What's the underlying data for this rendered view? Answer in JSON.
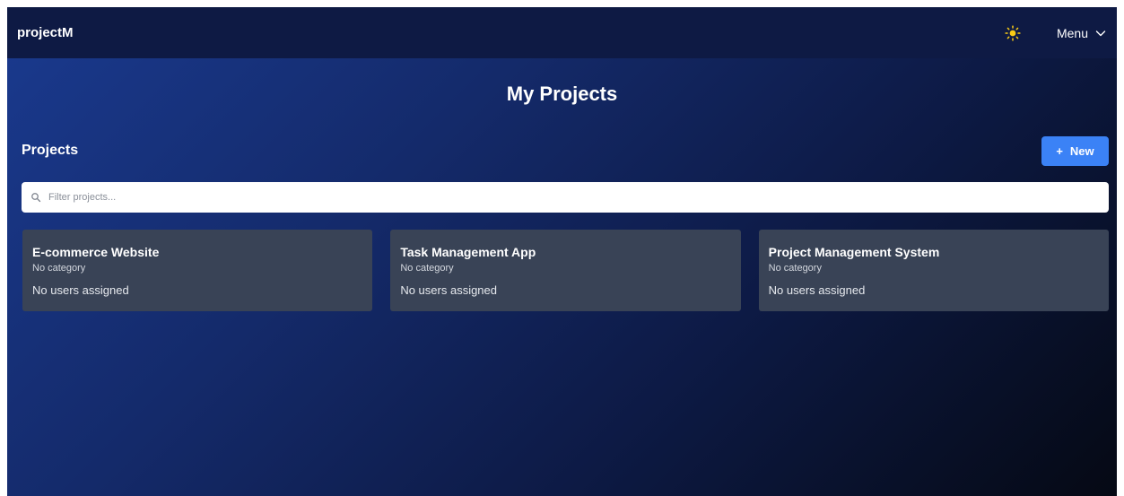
{
  "app": {
    "brand": "projectM"
  },
  "nav": {
    "theme_icon": "sun-icon",
    "menu_label": "Menu",
    "menu_icon": "chevron-down-icon"
  },
  "page": {
    "title": "My Projects"
  },
  "projects_section": {
    "title": "Projects",
    "new_button_label": "New",
    "new_button_icon": "plus-icon"
  },
  "search": {
    "placeholder": "Filter projects...",
    "value": "",
    "icon": "search-icon"
  },
  "projects": [
    {
      "name": "E-commerce Website",
      "category": "No category",
      "users": "No users assigned"
    },
    {
      "name": "Task Management App",
      "category": "No category",
      "users": "No users assigned"
    },
    {
      "name": "Project Management System",
      "category": "No category",
      "users": "No users assigned"
    }
  ],
  "colors": {
    "accent": "#3b82f6",
    "navbar": "#0e1a44",
    "card": "#394356",
    "sun": "#facc15"
  }
}
